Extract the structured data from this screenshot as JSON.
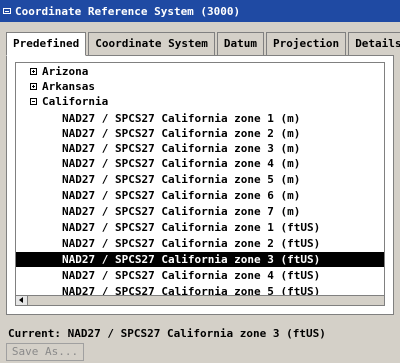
{
  "window": {
    "title": "Coordinate Reference System (3000)"
  },
  "tabs": [
    {
      "label": "Predefined",
      "active": true
    },
    {
      "label": "Coordinate System",
      "active": false
    },
    {
      "label": "Datum",
      "active": false
    },
    {
      "label": "Projection",
      "active": false
    },
    {
      "label": "Details",
      "active": false
    }
  ],
  "tree": {
    "states": [
      {
        "label": "Arizona",
        "expanded": false
      },
      {
        "label": "Arkansas",
        "expanded": false
      },
      {
        "label": "California",
        "expanded": true
      }
    ],
    "california_items": [
      "NAD27 / SPCS27 California zone 1 (m)",
      "NAD27 / SPCS27 California zone 2 (m)",
      "NAD27 / SPCS27 California zone 3 (m)",
      "NAD27 / SPCS27 California zone 4 (m)",
      "NAD27 / SPCS27 California zone 5 (m)",
      "NAD27 / SPCS27 California zone 6 (m)",
      "NAD27 / SPCS27 California zone 7 (m)",
      "NAD27 / SPCS27 California zone 1 (ftUS)",
      "NAD27 / SPCS27 California zone 2 (ftUS)",
      "NAD27 / SPCS27 California zone 3 (ftUS)",
      "NAD27 / SPCS27 California zone 4 (ftUS)",
      "NAD27 / SPCS27 California zone 5 (ftUS)"
    ],
    "selected_index": 9
  },
  "status": {
    "current": "Current: NAD27 / SPCS27 California zone 3 (ftUS)"
  },
  "buttons": {
    "save_as": "Save As..."
  },
  "colors": {
    "titlebar": "#1f4aa3",
    "selection": "#000000",
    "background": "#d4d0c8"
  }
}
